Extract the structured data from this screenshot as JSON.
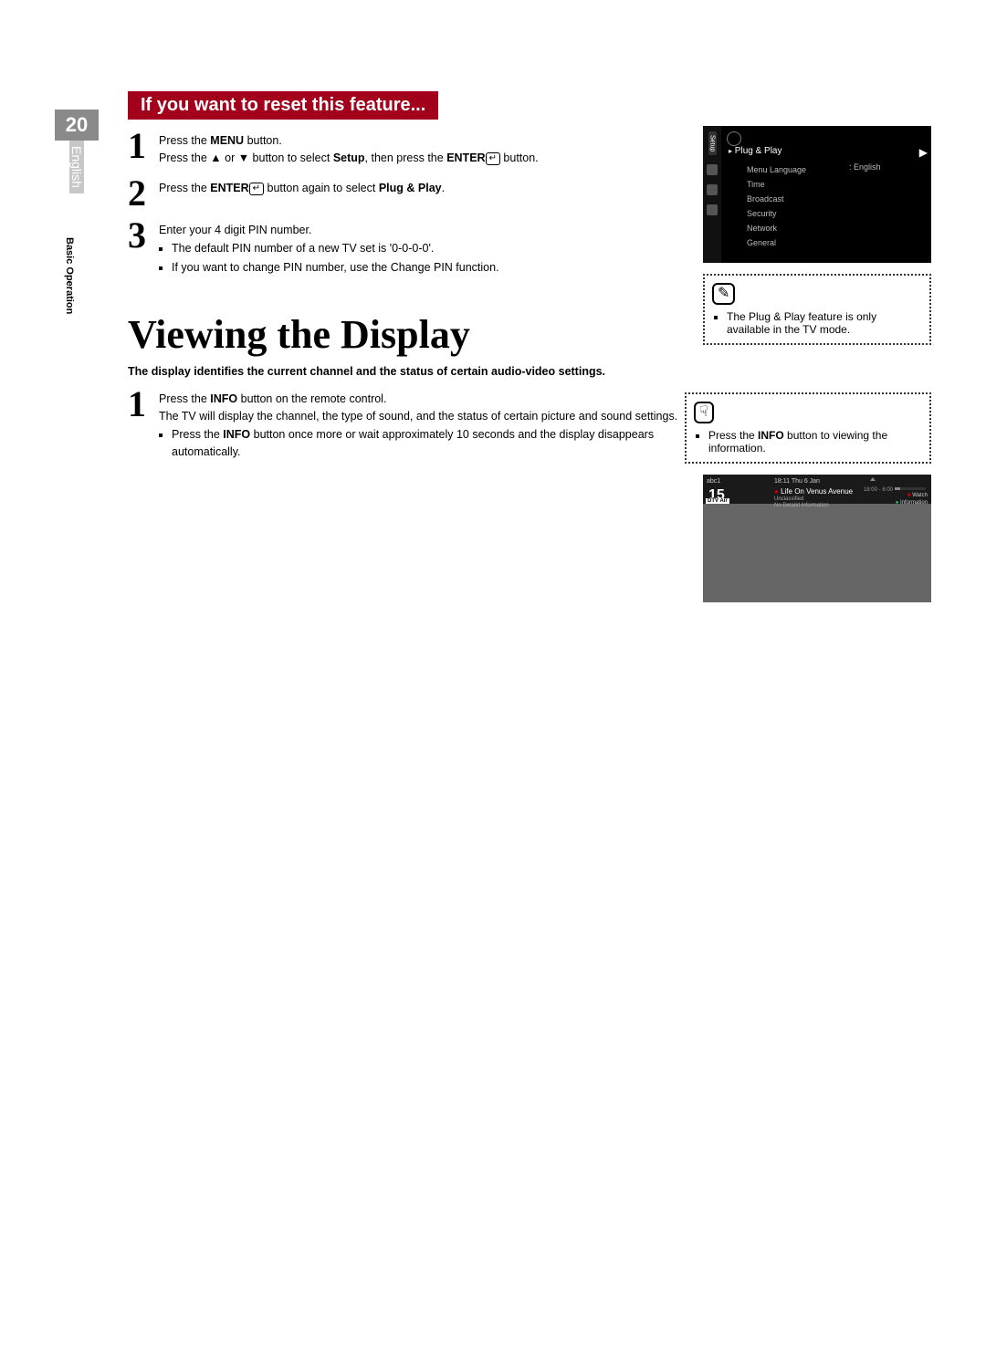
{
  "page_number": "20",
  "language": "English",
  "section_label": "Basic Operation",
  "banner": "If you want to reset this feature...",
  "steps_a": {
    "s1": {
      "n": "1",
      "l1a": "Press the ",
      "l1b": "MENU",
      "l1c": " button.",
      "l2a": "Press the ▲ or ▼ button to select ",
      "l2b": "Setup",
      "l2c": ", then press the ",
      "l2d": "ENTER",
      "l2e": " button."
    },
    "s2": {
      "n": "2",
      "a": "Press the ",
      "b": "ENTER",
      "c": " button again to select ",
      "d": "Plug & Play",
      "e": "."
    },
    "s3": {
      "n": "3",
      "a": "Enter your 4 digit PIN number.",
      "b": "The default PIN number of a new TV set is '0-0-0-0'.",
      "c": "If you want to change PIN number, use the Change PIN function."
    }
  },
  "osd": {
    "side_tab": "Setup",
    "title_prefix": "▸",
    "title": "Plug & Play",
    "arrow": "▶",
    "items": {
      "i0": "Menu Language",
      "i1": "Time",
      "i2": "Broadcast",
      "i3": "Security",
      "i4": "Network",
      "i5": "General"
    },
    "lang_label": ": English"
  },
  "note1": {
    "icon": "✎",
    "text": "The Plug & Play feature is only available in the TV mode."
  },
  "heading2": "Viewing the Display",
  "intro2": "The display identifies the current channel and the status of certain audio-video settings.",
  "steps_b": {
    "s1": {
      "n": "1",
      "l1a": "Press the ",
      "l1b": "INFO",
      "l1c": " button on the remote control.",
      "l2": "The TV will display the channel, the type of sound, and the status of certain picture and sound settings.",
      "l3a": "Press the ",
      "l3b": "INFO",
      "l3c": " button once more or wait approximately 10 seconds and the display disappears automatically."
    }
  },
  "note2": {
    "icon": "☟",
    "a": "Press the ",
    "b": "INFO",
    "c": " button to viewing the information."
  },
  "info_panel": {
    "provider": "abc1",
    "channel_number": "15",
    "badge": "DTV Air",
    "clock": "18:11 Thu 6 Jan",
    "rec_dot": "●",
    "title": "Life On Venus Avenue",
    "sub1": "Unclassified",
    "sub2": "No Detaild Information",
    "time_range": "18:00 - 6:00",
    "watch_sq": "■",
    "watch": " Watch",
    "info_dot": "●",
    "info": " Information"
  }
}
